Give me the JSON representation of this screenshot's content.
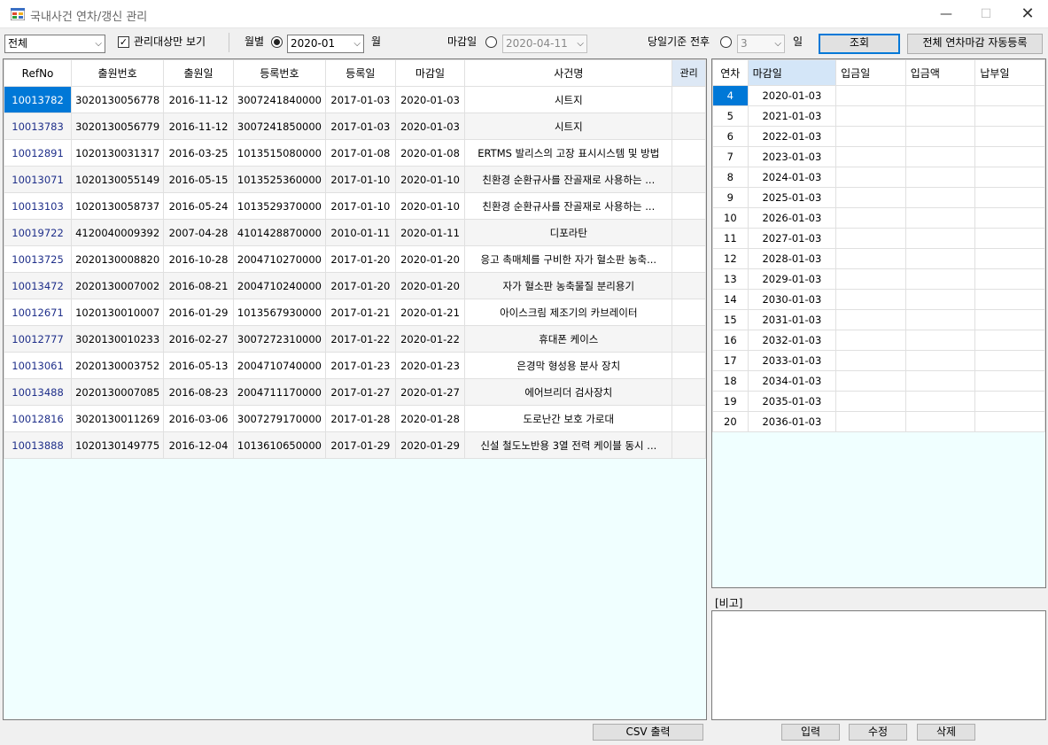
{
  "window": {
    "title": "국내사건 연차/갱신 관리",
    "minimize": "—",
    "maximize": "☐",
    "close": "✕"
  },
  "toolbar": {
    "scope_select": "전체",
    "managed_only_label": "관리대상만 보기",
    "managed_only_checked": true,
    "monthly_label": "월별",
    "month_value": "2020-01",
    "month_suffix": "월",
    "deadline_label": "마감일",
    "deadline_value": "2020-04-11",
    "day_basis_label": "당일기준 전후",
    "day_value": "3",
    "day_suffix": "일",
    "query_button": "조회",
    "auto_register_button": "전체 연차마감 자동등록"
  },
  "main_table": {
    "columns": [
      "RefNo",
      "출원번호",
      "출원일",
      "등록번호",
      "등록일",
      "마감일",
      "사건명",
      "관리"
    ],
    "rows": [
      [
        "10013782",
        "3020130056778",
        "2016-11-12",
        "3007241840000",
        "2017-01-03",
        "2020-01-03",
        "시트지",
        ""
      ],
      [
        "10013783",
        "3020130056779",
        "2016-11-12",
        "3007241850000",
        "2017-01-03",
        "2020-01-03",
        "시트지",
        ""
      ],
      [
        "10012891",
        "1020130031317",
        "2016-03-25",
        "1013515080000",
        "2017-01-08",
        "2020-01-08",
        "ERTMS 발리스의 고장 표시시스템 및 방법",
        ""
      ],
      [
        "10013071",
        "1020130055149",
        "2016-05-15",
        "1013525360000",
        "2017-01-10",
        "2020-01-10",
        "친환경 순환규사를 잔골재로 사용하는 ...",
        ""
      ],
      [
        "10013103",
        "1020130058737",
        "2016-05-24",
        "1013529370000",
        "2017-01-10",
        "2020-01-10",
        "친환경 순환규사를 잔골재로 사용하는 ...",
        ""
      ],
      [
        "10019722",
        "4120040009392",
        "2007-04-28",
        "4101428870000",
        "2010-01-11",
        "2020-01-11",
        "디포라탄",
        ""
      ],
      [
        "10013725",
        "2020130008820",
        "2016-10-28",
        "2004710270000",
        "2017-01-20",
        "2020-01-20",
        "응고 촉매체를 구비한 자가 혈소판 농축...",
        ""
      ],
      [
        "10013472",
        "2020130007002",
        "2016-08-21",
        "2004710240000",
        "2017-01-20",
        "2020-01-20",
        "자가 혈소판 농축물질 분리용기",
        ""
      ],
      [
        "10012671",
        "1020130010007",
        "2016-01-29",
        "1013567930000",
        "2017-01-21",
        "2020-01-21",
        "아이스크림 제조기의 카브레이터",
        ""
      ],
      [
        "10012777",
        "3020130010233",
        "2016-02-27",
        "3007272310000",
        "2017-01-22",
        "2020-01-22",
        "휴대폰 케이스",
        ""
      ],
      [
        "10013061",
        "2020130003752",
        "2016-05-13",
        "2004710740000",
        "2017-01-23",
        "2020-01-23",
        "은경막 형성용 분사 장치",
        ""
      ],
      [
        "10013488",
        "2020130007085",
        "2016-08-23",
        "2004711170000",
        "2017-01-27",
        "2020-01-27",
        "에어브리더 검사장치",
        ""
      ],
      [
        "10012816",
        "3020130011269",
        "2016-03-06",
        "3007279170000",
        "2017-01-28",
        "2020-01-28",
        "도로난간 보호 가로대",
        ""
      ],
      [
        "10013888",
        "1020130149775",
        "2016-12-04",
        "1013610650000",
        "2017-01-29",
        "2020-01-29",
        "신설 철도노반용 3열 전력 케이블 동시 ...",
        ""
      ]
    ]
  },
  "year_table": {
    "columns": [
      "연차",
      "마감일",
      "입금일",
      "입금액",
      "납부일"
    ],
    "rows": [
      [
        "4",
        "2020-01-03"
      ],
      [
        "5",
        "2021-01-03"
      ],
      [
        "6",
        "2022-01-03"
      ],
      [
        "7",
        "2023-01-03"
      ],
      [
        "8",
        "2024-01-03"
      ],
      [
        "9",
        "2025-01-03"
      ],
      [
        "10",
        "2026-01-03"
      ],
      [
        "11",
        "2027-01-03"
      ],
      [
        "12",
        "2028-01-03"
      ],
      [
        "13",
        "2029-01-03"
      ],
      [
        "14",
        "2030-01-03"
      ],
      [
        "15",
        "2031-01-03"
      ],
      [
        "16",
        "2032-01-03"
      ],
      [
        "17",
        "2033-01-03"
      ],
      [
        "18",
        "2034-01-03"
      ],
      [
        "19",
        "2035-01-03"
      ],
      [
        "20",
        "2036-01-03"
      ]
    ]
  },
  "note": {
    "label": "[비고]",
    "value": ""
  },
  "bottom": {
    "csv_button": "CSV 출력",
    "input_button": "입력",
    "edit_button": "수정",
    "delete_button": "삭제"
  },
  "colors": {
    "selection": "#0078d7",
    "grid_bg": "#f0ffff",
    "refno_text": "#1f2f8a"
  }
}
